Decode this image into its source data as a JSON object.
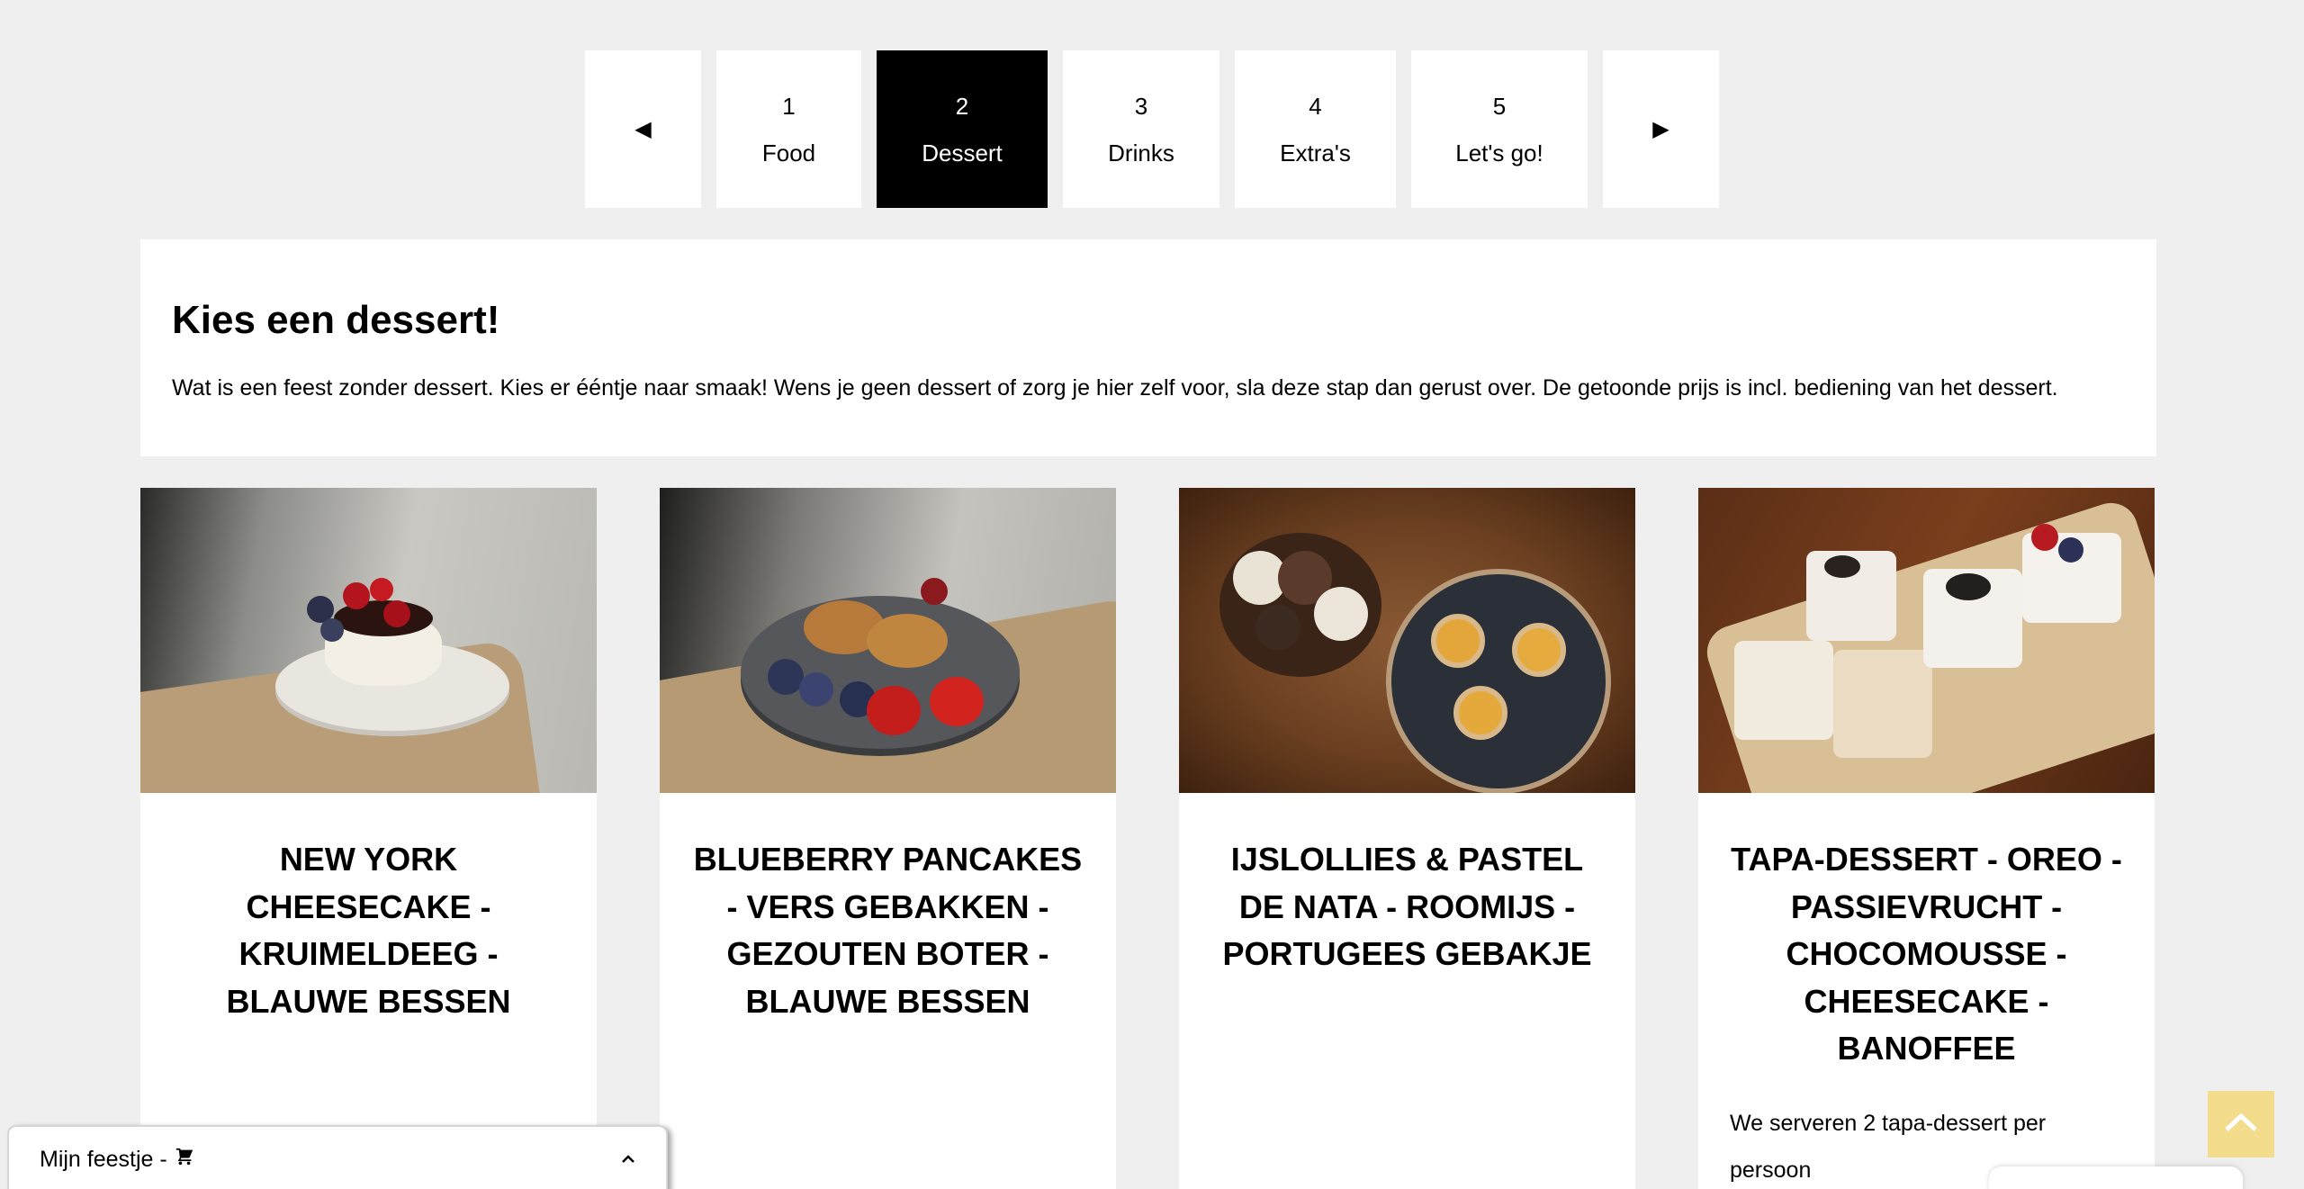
{
  "stepper": {
    "prev": "◀",
    "next": "▶",
    "steps": [
      {
        "num": "1",
        "label": "Food"
      },
      {
        "num": "2",
        "label": "Dessert"
      },
      {
        "num": "3",
        "label": "Drinks"
      },
      {
        "num": "4",
        "label": "Extra's"
      },
      {
        "num": "5",
        "label": "Let's go!"
      }
    ],
    "active_step": 2
  },
  "intro": {
    "heading": "Kies een dessert!",
    "text": "Wat is een feest zonder dessert. Kies er ééntje naar smaak! Wens je geen dessert of zorg je hier zelf voor, sla deze stap dan gerust over. De getoonde prijs is incl. bediening van het dessert."
  },
  "cards": [
    {
      "title": "NEW YORK CHEESECAKE - KRUIMELDEEG - BLAUWE BESSEN",
      "description": ""
    },
    {
      "title": "BLUEBERRY PANCAKES - VERS GEBAKKEN - GEZOUTEN BOTER - BLAUWE BESSEN",
      "description": ""
    },
    {
      "title": "IJSLOLLIES & PASTEL DE NATA - ROOMIJS - PORTUGEES GEBAKJE",
      "description": ""
    },
    {
      "title": "TAPA-DESSERT - OREO - PASSIEVRUCHT - CHOCOMOUSSE - CHEESECAKE - BANOFFEE",
      "description": "We serveren 2 tapa-dessert per persoon"
    }
  ],
  "cart": {
    "label": "Mijn feestje -",
    "icon": "cart-icon",
    "chevron": "chevron-up-icon"
  },
  "colors": {
    "background": "#efefef",
    "active_step": "#000000",
    "back_to_top": "#f3dc8c"
  }
}
